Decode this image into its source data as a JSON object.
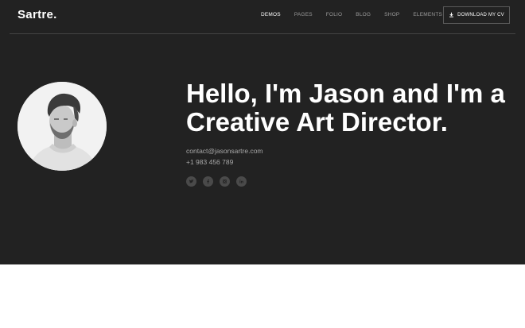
{
  "brand": {
    "logo": "Sartre."
  },
  "nav": {
    "items": [
      {
        "label": "DEMOS",
        "active": true
      },
      {
        "label": "PAGES",
        "active": false
      },
      {
        "label": "FOLIO",
        "active": false
      },
      {
        "label": "BLOG",
        "active": false
      },
      {
        "label": "SHOP",
        "active": false
      },
      {
        "label": "ELEMENTS",
        "active": false
      }
    ],
    "cv_button": {
      "label": "DOWNLOAD MY CV",
      "icon": "download-icon"
    }
  },
  "hero": {
    "headline": "Hello, I'm Jason and I'm a Creative Art Director.",
    "email": "contact@jasonsartre.com",
    "phone": "+1 983 456 789",
    "socials": [
      {
        "name": "twitter",
        "icon": "twitter-icon"
      },
      {
        "name": "facebook",
        "icon": "facebook-icon"
      },
      {
        "name": "instagram",
        "icon": "instagram-icon"
      },
      {
        "name": "linkedin",
        "icon": "linkedin-icon"
      }
    ]
  },
  "colors": {
    "hero_background": "#222222",
    "page_background": "#ffffff",
    "text_primary": "#ffffff",
    "text_muted": "#a8a8a8",
    "social_circle": "#4a4a4a"
  }
}
